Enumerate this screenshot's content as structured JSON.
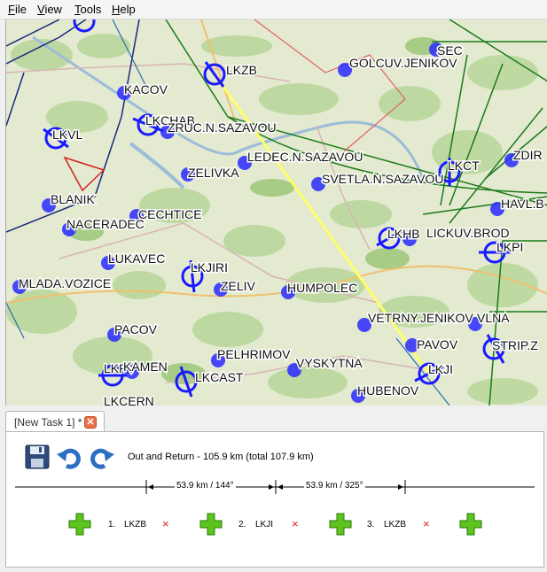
{
  "menu": [
    "File",
    "View",
    "Tools",
    "Help"
  ],
  "menu_accelerators": [
    "F",
    "V",
    "T",
    "H"
  ],
  "tab": {
    "label": "[New Task 1] *",
    "close_glyph": "✕"
  },
  "summary": "Out and Return - 105.9 km (total 107.9 km)",
  "legs": [
    "53.9 km / 144°",
    "53.9 km / 325°"
  ],
  "turnpoints": [
    {
      "num": "1.",
      "code": "LKZB"
    },
    {
      "num": "2.",
      "code": "LKJI"
    },
    {
      "num": "3.",
      "code": "LKZB"
    }
  ],
  "remove_glyph": "×",
  "map": {
    "towns": [
      "KACOV",
      "ZRUC.N.SAZAVOU",
      "LEDEC.N.SAZAVOU",
      "SVETLA.N.SAZAVOU",
      "ZELIVKA",
      "BLANIK",
      "NACERADEC",
      "CECHTICE",
      "LUKAVEC",
      "MLADA.VOZICE",
      "ZELIV",
      "HUMPOLEC",
      "PACOV",
      "PELHRIMOV",
      "VYSKYTNA",
      "HUBENOV",
      "GOLCUV.JENIKOV",
      "SEC",
      "ZDIR",
      "HAVL.B",
      "LICKUV.BROD",
      "VETRNY.JENIKOV",
      "VLNA",
      "PAVOV",
      "STRIP.Z",
      "KAMEN",
      "LKCERN"
    ],
    "airfields": [
      "LKZB",
      "LKCHAB",
      "LKVL",
      "LKJIRI",
      "LKCT",
      "LKHB",
      "LKPI",
      "LKJI",
      "LKCAST",
      "LKPV"
    ],
    "colors": {
      "task_line": "#ffff66",
      "airspace_green": "#1a7a1a",
      "airspace_navy": "#1a2a7a",
      "red_zone": "#d42020",
      "town_dot": "#2a2aff"
    }
  },
  "icons": [
    "save-icon",
    "undo-icon",
    "redo-icon",
    "add-turnpoint-icon",
    "remove-icon"
  ]
}
